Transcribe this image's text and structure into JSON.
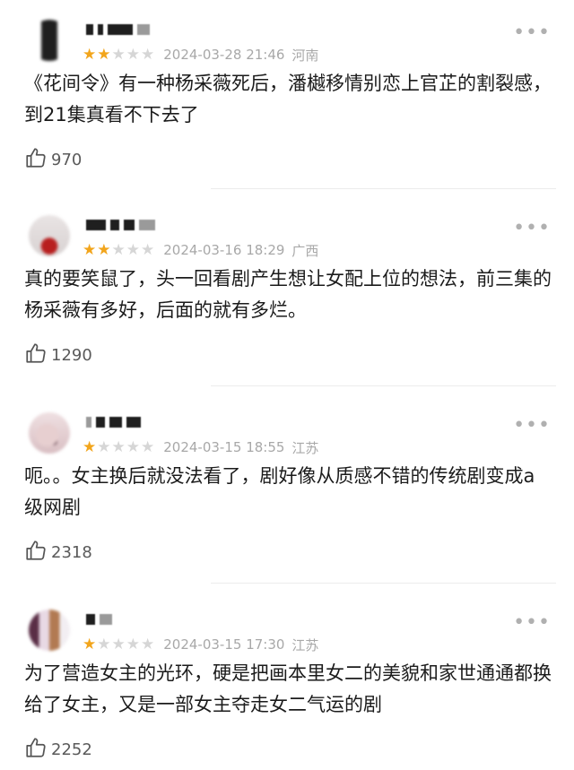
{
  "reviews": [
    {
      "rating": 2,
      "time": "2024-03-28 21:46",
      "region": "河南",
      "text": "《花间令》有一种杨采薇死后，潘樾移情别恋上官芷的割裂感，到21集真看不下去了",
      "likes": "970",
      "avatar_icon": "blurred-avatar"
    },
    {
      "rating": 2,
      "time": "2024-03-16 18:29",
      "region": "广西",
      "text": "真的要笑鼠了，头一回看剧产生想让女配上位的想法，前三集的杨采薇有多好，后面的就有多烂。",
      "likes": "1290",
      "avatar_icon": "blurred-avatar"
    },
    {
      "rating": 1,
      "time": "2024-03-15 18:55",
      "region": "江苏",
      "text": "呃。。女主换后就没法看了，剧好像从质感不错的传统剧变成a级网剧",
      "likes": "2318",
      "avatar_icon": "blurred-avatar"
    },
    {
      "rating": 1,
      "time": "2024-03-15 17:30",
      "region": "江苏",
      "text": "为了营造女主的光环，硬是把画本里女二的美貌和家世通通都换给了女主，又是一部女主夺走女二气运的剧",
      "likes": "2252",
      "avatar_icon": "blurred-avatar"
    }
  ],
  "icons": {
    "like": "thumbs-up-icon",
    "more": "more-dots-icon",
    "star": "star-icon"
  },
  "colors": {
    "star_on": "#f2a51c",
    "star_off": "#d6d6d6",
    "meta_text": "#a8a8a8"
  }
}
